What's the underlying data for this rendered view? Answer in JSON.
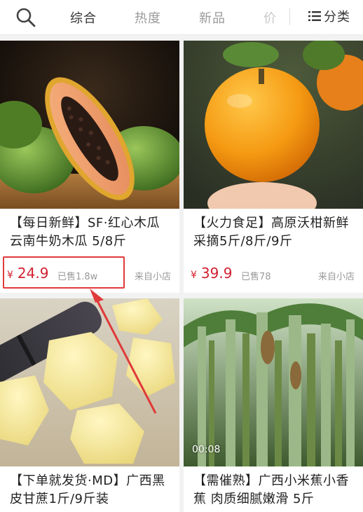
{
  "header": {
    "tabs": [
      {
        "label": "综合"
      },
      {
        "label": "热度"
      },
      {
        "label": "新品"
      },
      {
        "label": "价"
      }
    ],
    "category_label": "分类"
  },
  "products": [
    {
      "title": "【每日新鲜】SF·红心木瓜 云南牛奶木瓜 5/8斤",
      "price": "24.9",
      "currency": "¥",
      "sold": "已售1.8w",
      "from": "来自小店"
    },
    {
      "title": "【火力食足】高原沃柑新鲜采摘5斤/8斤/9斤",
      "price": "39.9",
      "currency": "¥",
      "sold": "已售78",
      "from": "来自小店"
    },
    {
      "title": "【下单就发货·MD】广西黑皮甘蔗1斤/9斤装"
    },
    {
      "title": "【需催熟】广西小米蕉小香蕉 肉质细腻嫩滑 5斤",
      "video_time": "00:08"
    }
  ],
  "colors": {
    "price": "#d21f2f",
    "annotation": "#e03a3a"
  }
}
